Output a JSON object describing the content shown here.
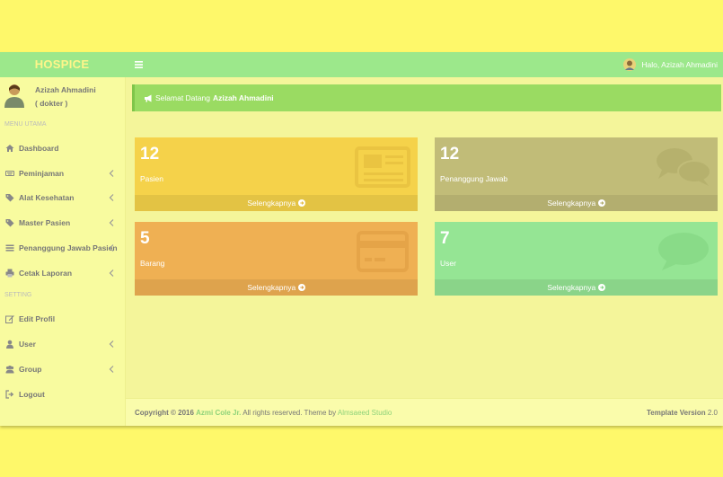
{
  "header": {
    "logo": "HOSPICE",
    "toggle_icon": "hamburger-icon",
    "greeting": "Halo, Azizah Ahmadini"
  },
  "sidebar": {
    "user_name": "Azizah Ahmadini",
    "user_role": "( dokter )",
    "section_main": "MENU UTAMA",
    "section_setting": "SETTING",
    "items": [
      {
        "label": "Dashboard",
        "icon": "home-icon"
      },
      {
        "label": "Peminjaman",
        "icon": "keyboard-icon"
      },
      {
        "label": "Alat Kesehatan",
        "icon": "tags-icon"
      },
      {
        "label": "Master Pasien",
        "icon": "tags-icon"
      },
      {
        "label": "Penanggung Jawab Pasien",
        "icon": "list-icon"
      },
      {
        "label": "Cetak Laporan",
        "icon": "print-icon"
      },
      {
        "label": "Edit Profil",
        "icon": "edit-icon"
      },
      {
        "label": "User",
        "icon": "user-icon"
      },
      {
        "label": "Group",
        "icon": "users-icon"
      },
      {
        "label": "Logout",
        "icon": "sign-out-icon"
      }
    ]
  },
  "welcome": {
    "prefix": "Selamat Datang",
    "name": "Azizah Ahmadini"
  },
  "boxes": [
    {
      "number": "12",
      "label": "Pasien",
      "footer": "Selengkapnya",
      "color": "#f5d24a",
      "icon": "newspaper-icon"
    },
    {
      "number": "12",
      "label": "Penanggung Jawab",
      "footer": "Selengkapnya",
      "color": "#c1bc78",
      "icon": "comments-icon"
    },
    {
      "number": "5",
      "label": "Barang",
      "footer": "Selengkapnya",
      "color": "#efb053",
      "icon": "credit-card-icon"
    },
    {
      "number": "7",
      "label": "User",
      "footer": "Selengkapnya",
      "color": "#95e594",
      "icon": "comment-icon"
    }
  ],
  "footer": {
    "copyright_prefix": "Copyright © 2016",
    "author": "Azmi Cole Jr.",
    "rights": "All rights reserved. Theme by",
    "studio": "Almsaeed Studio",
    "version_label": "Template Version",
    "version": "2.0"
  }
}
